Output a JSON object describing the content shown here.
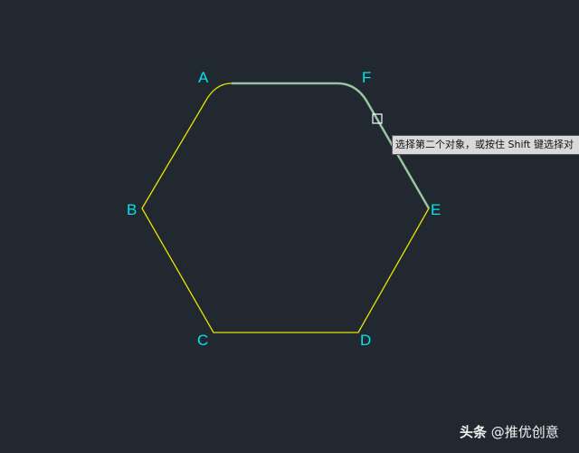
{
  "drawing": {
    "vertices": {
      "a": "A",
      "b": "B",
      "c": "C",
      "d": "D",
      "e": "E",
      "f": "F"
    },
    "colors": {
      "background": "#212830",
      "polyline": "#e6e600",
      "highlight": "#7fb6d6",
      "label": "#00e5ee"
    }
  },
  "tooltip": {
    "text": "选择第二个对象，或按住 Shift 键选择对"
  },
  "watermark": {
    "brand": "头条",
    "handle": "@推优创意"
  }
}
